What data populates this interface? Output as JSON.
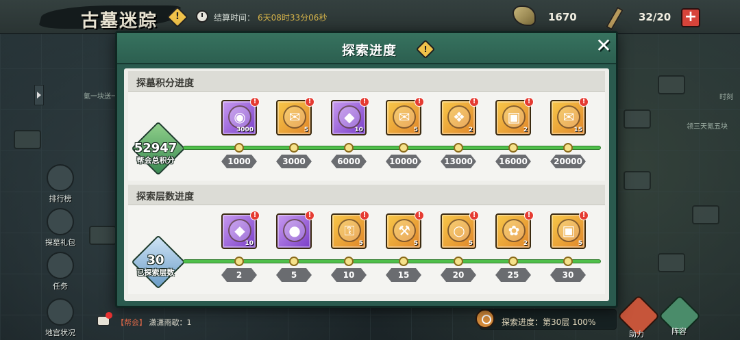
{
  "topbar": {
    "game_title": "古墓迷踪",
    "settle_label": "结算时间：",
    "settle_time": "6天08时33分06秒",
    "resource_1": "1670",
    "resource_2": "32/20",
    "plus_label": "+"
  },
  "side_menu": {
    "ranking": "排行榜",
    "gift": "探墓礼包",
    "tasks": "任务",
    "status": "地宫状况"
  },
  "background_notes": {
    "left": "氪一块送一",
    "right_1": "时刻",
    "right_2": "领三天氪五块"
  },
  "bottom": {
    "chat_tag": "【帮会】",
    "chat_msg": "潇潇雨歇：1",
    "progress_text": "探索进度：第30层 100%",
    "help_label": "助力",
    "formation_label": "阵容"
  },
  "modal": {
    "title": "探索进度",
    "warn_symbol": "!",
    "close_symbol": "✕",
    "sections": [
      {
        "title": "探墓积分进度",
        "badge_value": "52947",
        "badge_label": "帮会总积分",
        "milestones": [
          {
            "label": "1000",
            "icon": "gold-medal-icon",
            "qty": "3000",
            "style": "purple"
          },
          {
            "label": "3000",
            "icon": "scroll-icon",
            "qty": "5",
            "style": "gold"
          },
          {
            "label": "6000",
            "icon": "gem-chest-icon",
            "qty": "10",
            "style": "purple"
          },
          {
            "label": "10000",
            "icon": "scroll-icon",
            "qty": "5",
            "style": "gold"
          },
          {
            "label": "13000",
            "icon": "treasure-pile-icon",
            "qty": "2",
            "style": "gold"
          },
          {
            "label": "16000",
            "icon": "treasure-chest-icon",
            "qty": "2",
            "style": "gold"
          },
          {
            "label": "20000",
            "icon": "scroll-icon",
            "qty": "15",
            "style": "gold"
          }
        ]
      },
      {
        "title": "探索层数进度",
        "badge_value": "30",
        "badge_label": "已探索层数",
        "milestones": [
          {
            "label": "2",
            "icon": "gem-chest-icon",
            "qty": "10",
            "style": "purple"
          },
          {
            "label": "5",
            "icon": "green-orb-icon",
            "qty": "",
            "style": "purple"
          },
          {
            "label": "10",
            "icon": "key-icon",
            "qty": "5",
            "style": "gold"
          },
          {
            "label": "15",
            "icon": "axe-icon",
            "qty": "5",
            "style": "gold"
          },
          {
            "label": "20",
            "icon": "pearl-shell-icon",
            "qty": "5",
            "style": "gold"
          },
          {
            "label": "25",
            "icon": "golden-lotus-icon",
            "qty": "2",
            "style": "gold"
          },
          {
            "label": "30",
            "icon": "treasure-chest-icon",
            "qty": "5",
            "style": "gold"
          }
        ]
      }
    ]
  },
  "colors": {
    "modal_frame": "#2a5a4e",
    "track_green": "#4fbf4a",
    "alert_red": "#e53b32",
    "gold_tile": "#f8c84a",
    "purple_tile": "#7a3ec8"
  }
}
